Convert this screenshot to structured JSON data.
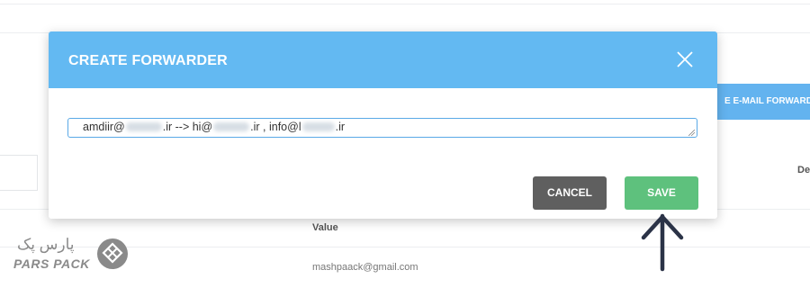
{
  "background": {
    "header_button_label": "E E-MAIL FORWARD",
    "column_partial": "De",
    "column_value": "Value",
    "row_email": "mashpaack@gmail.com"
  },
  "modal": {
    "title": "CREATE FORWARDER",
    "input": {
      "part1": "amdiir@",
      "part2": ".ir --> hi@",
      "part3": ".ir , info@l",
      "part4": ".ir"
    },
    "cancel_label": "CANCEL",
    "save_label": "SAVE"
  },
  "logo": {
    "latin": "PARS PACK",
    "persian": "پارس پک"
  },
  "colors": {
    "header": "#63b9f2",
    "save": "#5ec17d",
    "cancel": "#5f5f5f",
    "arrow": "#2b3347"
  },
  "icons": [
    "close-icon",
    "up-arrow-icon",
    "parspack-logo-icon"
  ]
}
